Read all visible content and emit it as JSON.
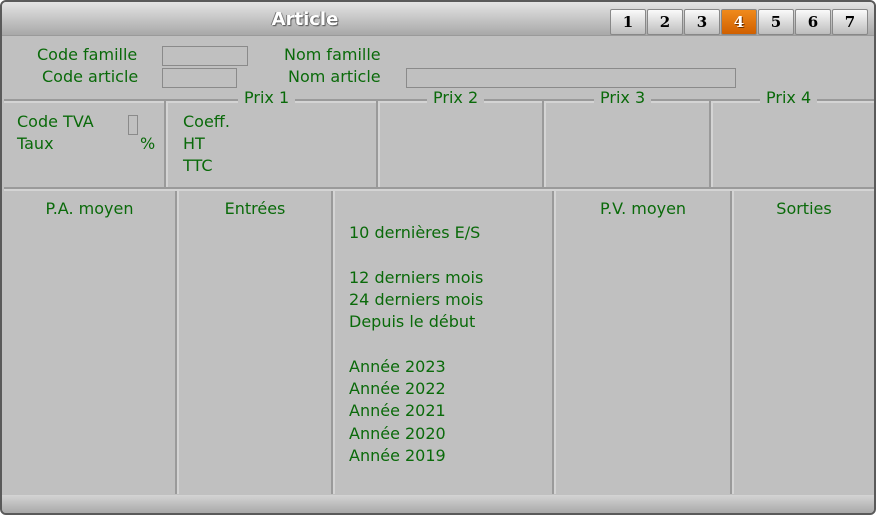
{
  "window": {
    "title": "Article"
  },
  "tabs": [
    {
      "label": "1",
      "active": false
    },
    {
      "label": "2",
      "active": false
    },
    {
      "label": "3",
      "active": false
    },
    {
      "label": "4",
      "active": true
    },
    {
      "label": "5",
      "active": false
    },
    {
      "label": "6",
      "active": false
    },
    {
      "label": "7",
      "active": false
    }
  ],
  "header": {
    "code_famille_label": "Code famille",
    "code_famille_value": "",
    "nom_famille_label": "Nom famille",
    "code_article_label": "Code article",
    "code_article_value": "",
    "nom_article_label": "Nom article",
    "nom_article_value": ""
  },
  "tva": {
    "code_tva_label": "Code TVA",
    "code_tva_value": "",
    "taux_label": "Taux",
    "taux_unit": "%"
  },
  "prix": {
    "groups": [
      "Prix 1",
      "Prix 2",
      "Prix 3",
      "Prix 4"
    ],
    "coeff_label": "Coeff.",
    "ht_label": "HT",
    "ttc_label": "TTC"
  },
  "stats": {
    "columns": {
      "pa_moyen": "P.A. moyen",
      "entrees": "Entrées",
      "pv_moyen": "P.V. moyen",
      "sorties": "Sorties"
    },
    "periods": {
      "last10": "10 dernières E/S",
      "m12": "12 derniers mois",
      "m24": "24 derniers mois",
      "since_start": "Depuis le début",
      "years": [
        "Année 2023",
        "Année 2022",
        "Année 2021",
        "Année 2020",
        "Année 2019"
      ]
    }
  }
}
